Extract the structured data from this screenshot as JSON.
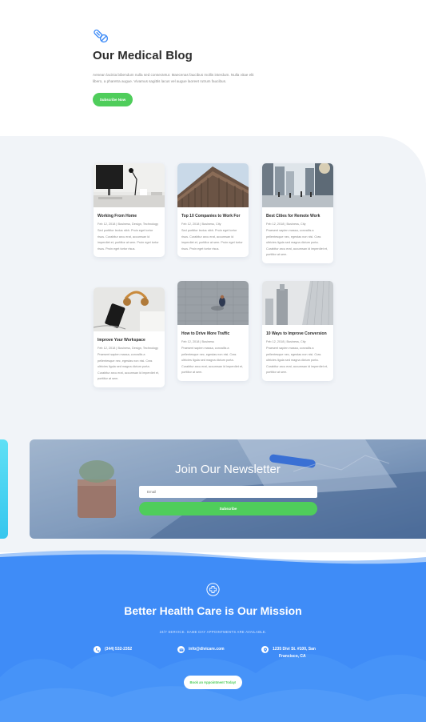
{
  "hero": {
    "icon": "pills-icon",
    "title": "Our Medical Blog",
    "description": "Aenean lacinia bibendum nulla sed consectetur. Maecenas faucibus mollis interdum. Nulla vitae elit libero, a pharetra augue. Vivamus sagittis lacus vel augue laoreet rutrum faucibus.",
    "button": "Subscribe Now"
  },
  "posts": [
    {
      "title": "Working From Home",
      "meta": "Feb 12, 2018 | Business, Design, Technology",
      "excerpt": "Sed porttitor lectus nibh. Proin eget tortor risus. Curabitur arcu erat, accumsan id imperdiet et, porttitor at sem. Proin eget tortor risus. Proin eget tortor risus.",
      "image": "desk-monitor-photo"
    },
    {
      "title": "Top 10 Companies to Work For",
      "meta": "Feb 12, 2018 | Business, City",
      "excerpt": "Sed porttitor lectus nibh. Proin eget tortor risus. Curabitur arcu erat, accumsan id imperdiet et, porttitor at sem. Proin eget tortor risus. Proin eget tortor risus.",
      "image": "building-photo"
    },
    {
      "title": "Best Cities for Remote Work",
      "meta": "Feb 12, 2018 | Business, City",
      "excerpt": "Praesent sapien massa, convallis a pellentesque nec, egestas non nisi. Cras ultricies ligula sed magna dictum porta. Curabitur arcu erat, accumsan id imperdiet et, porttitor at sem.",
      "image": "city-street-photo"
    },
    {
      "title": "Improve Your Workspace",
      "meta": "Feb 12, 2018 | Business, Design, Technology",
      "excerpt": "Praesent sapien massa, convallis a pellentesque nec, egestas non nisi. Cras ultricies ligula sed magna dictum porta. Curabitur arcu erat, accumsan id imperdiet et, porttitor at sem.",
      "image": "workspace-photo"
    },
    {
      "title": "How to Drive More Traffic",
      "meta": "Feb 12, 2018 | Business",
      "excerpt": "Praesent sapien massa, convallis a pellentesque nec, egestas non nisi. Cras ultricies ligula sed magna dictum porta. Curabitur arcu erat, accumsan id imperdiet et, porttitor at sem.",
      "image": "pedestrian-photo"
    },
    {
      "title": "10 Ways to Improve Conversion",
      "meta": "Feb 12, 2018 | Business, City",
      "excerpt": "Praesent sapien massa, convallis a pellentesque nec, egestas non nisi. Cras ultricies ligula sed magna dictum porta. Curabitur arcu erat, accumsan id imperdiet et, porttitor at sem.",
      "image": "skyscraper-photo"
    }
  ],
  "newsletter": {
    "title": "Join Our Newsletter",
    "email_placeholder": "Email",
    "button": "Subscribe"
  },
  "footer": {
    "icon": "medical-cross-icon",
    "title": "Better Health Care is Our Mission",
    "subtitle": "24/7 SERVICE. SAME DAY APPOINTMENTS ARE AVAILABLE.",
    "phone": "(344) 532-2352",
    "email": "info@divicare.com",
    "address_line1": "1235 Divi St. #100, San",
    "address_line2": "Francisco, CA",
    "button": "Book an Appointment Today!"
  },
  "colors": {
    "accent_green": "#4fcd5b",
    "footer_blue": "#3f8cf7",
    "blog_bg": "#f1f4f8",
    "title_dark": "#2d2d2d"
  }
}
